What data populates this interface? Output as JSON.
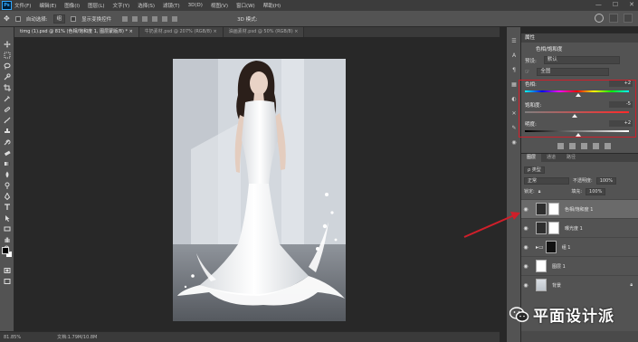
{
  "menubar": {
    "logo": "Ps",
    "items": [
      "文件(F)",
      "编辑(E)",
      "图像(I)",
      "图层(L)",
      "文字(Y)",
      "选择(S)",
      "滤镜(T)",
      "3D(D)",
      "视图(V)",
      "窗口(W)",
      "帮助(H)"
    ],
    "window_controls": [
      "—",
      "☐",
      "✕"
    ]
  },
  "options": {
    "auto_select_label": "自动选择:",
    "auto_select_value": "组",
    "show_transform_label": "显示变换控件",
    "mode_label": "3D 模式:"
  },
  "tabs": [
    {
      "label": "timg (1).psd @ 81% (色相/饱和度 1, 图层蒙版/8) * ×",
      "active": true
    },
    {
      "label": "牛奶素材.psd @ 207% (RGB/8) ×",
      "active": false
    },
    {
      "label": "油画素材.psd @ 50% (RGB/8) ×",
      "active": false
    }
  ],
  "status": {
    "zoom": "81.85%",
    "doc": "文档:1.79M/10.8M"
  },
  "properties": {
    "header": "属性",
    "title": "色相/饱和度",
    "preset_label": "预设:",
    "preset_value": "默认",
    "channel_value": "全图",
    "hue_label": "色相:",
    "hue_value": "+2",
    "saturation_label": "饱和度:",
    "saturation_value": "-5",
    "lightness_label": "明度:",
    "lightness_value": "+2",
    "hue_level": 0.51,
    "saturation_level": 0.48,
    "lightness_level": 0.51
  },
  "layers": {
    "tabs": [
      "图层",
      "通道",
      "路径"
    ],
    "filter_value": "ρ 类型",
    "blend_mode": "正常",
    "opacity_label": "不透明度:",
    "opacity_value": "100%",
    "lock_label": "锁定:",
    "fill_label": "填充:",
    "fill_value": "100%",
    "items": [
      {
        "name": "色相/饱和度 1",
        "selected": true
      },
      {
        "name": "曝光度 1",
        "selected": false
      },
      {
        "name": "组 1",
        "selected": false
      },
      {
        "name": "图层 1",
        "selected": false
      },
      {
        "name": "背景",
        "selected": false
      }
    ]
  },
  "watermark": {
    "text": "平面设计派"
  },
  "colors": {
    "highlight": "#d01f2a",
    "arrow": "#d01f2a"
  }
}
